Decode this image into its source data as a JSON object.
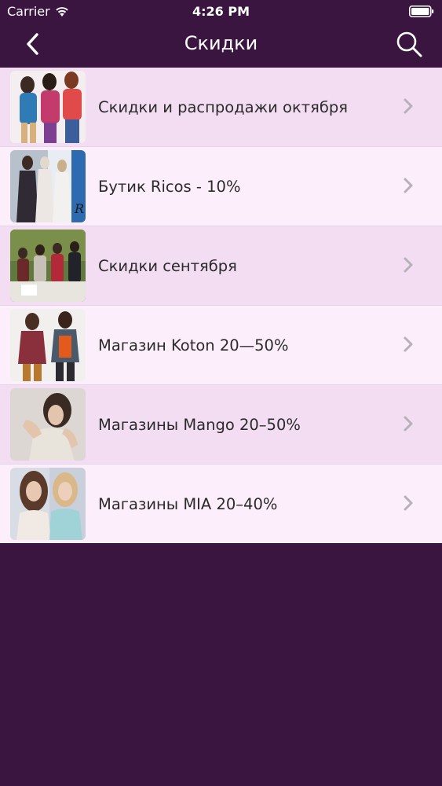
{
  "status_bar": {
    "carrier": "Carrier",
    "time": "4:26 PM",
    "wifi_icon": "wifi-icon",
    "battery_icon": "battery-icon"
  },
  "nav": {
    "title": "Скидки",
    "back_icon": "chevron-left-icon",
    "search_icon": "search-icon"
  },
  "colors": {
    "nav_bg": "#3a1540",
    "row_odd": "#f3ddf3",
    "row_even": "#fdeefb",
    "label_text": "#2b2b2b",
    "chevron": "#b8b0b8"
  },
  "items": [
    {
      "label": "Скидки и распродажи октября",
      "thumbnail": "thumbnail-image"
    },
    {
      "label": "Бутик Ricos - 10%",
      "thumbnail": "thumbnail-image"
    },
    {
      "label": "Скидки сентября",
      "thumbnail": "thumbnail-image"
    },
    {
      "label": "Магазин Koton 20—50%",
      "thumbnail": "thumbnail-image"
    },
    {
      "label": "Магазины Mango 20–50%",
      "thumbnail": "thumbnail-image"
    },
    {
      "label": "Магазины MIA 20–40%",
      "thumbnail": "thumbnail-image"
    }
  ]
}
